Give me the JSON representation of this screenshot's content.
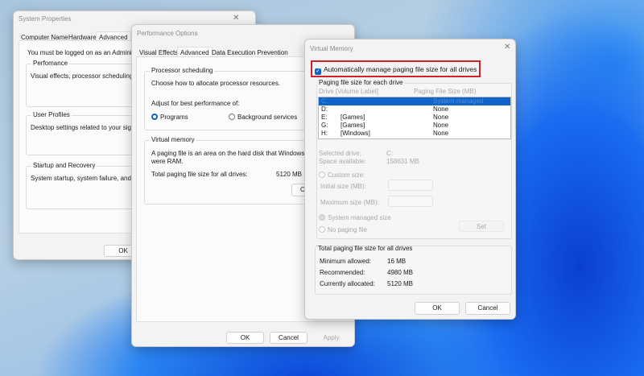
{
  "system_properties": {
    "title": "System Properties",
    "tabs": [
      "Computer Name",
      "Hardware",
      "Advanced"
    ],
    "admin_note": "You must be logged on as an Administrato",
    "performance": {
      "label": "Perfomance",
      "text": "Visual effects, processor scheduling, me"
    },
    "user_profiles": {
      "label": "User Profiles",
      "text": "Desktop settings related to your sign-in"
    },
    "startup": {
      "label": "Startup and Recovery",
      "text": "System startup, system failure, and debu"
    },
    "ok": "OK"
  },
  "performance_options": {
    "title": "Performance Options",
    "tabs": [
      "Visual Effects",
      "Advanced",
      "Data Execution Prevention"
    ],
    "processor": {
      "label": "Processor scheduling",
      "text": "Choose how to allocate processor resources.",
      "adjust": "Adjust for best performance of:",
      "programs": "Programs",
      "background": "Background services",
      "selected": "Programs"
    },
    "virtual_memory": {
      "label": "Virtual memory",
      "text1": "A paging file is an area on the hard disk that Windows",
      "text2": "were RAM.",
      "total_label": "Total paging file size for all drives:",
      "total_value": "5120 MB",
      "change": "C"
    },
    "ok": "OK",
    "cancel": "Cancel",
    "apply": "Apply"
  },
  "virtual_memory": {
    "title": "Virtual Memory",
    "auto_manage": "Automatically manage paging file size for all drives",
    "auto_manage_checked": true,
    "highlight_color": "#d0202a",
    "group_label": "Paging file size for each drive",
    "col_drive": "Drive  [Volume Label]",
    "col_size": "Paging File Size (MB)",
    "drives": [
      {
        "drive": "C:",
        "label": "",
        "size": "System managed",
        "selected": true
      },
      {
        "drive": "D:",
        "label": "",
        "size": "None"
      },
      {
        "drive": "E:",
        "label": "[Games]",
        "size": "None"
      },
      {
        "drive": "G:",
        "label": "[Games]",
        "size": "None"
      },
      {
        "drive": "H:",
        "label": "[Windows]",
        "size": "None"
      }
    ],
    "selected_drive_label": "Selected drive:",
    "selected_drive": "C:",
    "space_label": "Space available:",
    "space": "158631 MB",
    "custom_size": "Custom size:",
    "initial_size": "Initial size (MB):",
    "maximum_size": "Maximum size (MB):",
    "system_managed": "System managed size",
    "no_paging": "No paging file",
    "set": "Set",
    "totals_label": "Total paging file size for all drives",
    "min_label": "Minimum allowed:",
    "min": "16 MB",
    "rec_label": "Recommended:",
    "rec": "4980 MB",
    "cur_label": "Currently allocated:",
    "cur": "5120 MB",
    "ok": "OK",
    "cancel": "Cancel"
  }
}
